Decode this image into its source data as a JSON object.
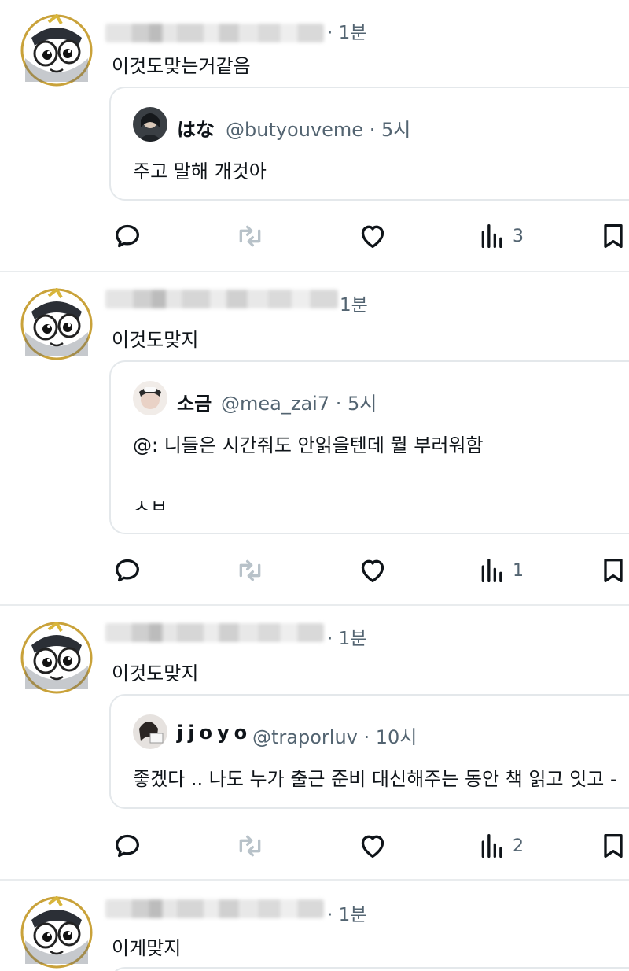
{
  "posts": [
    {
      "time": "· 1분",
      "text": "이것도맞는거같음",
      "quote": {
        "name": "はな",
        "handle": "@butyouveme · 5시",
        "lines": [
          "주고 말해 개것아"
        ]
      },
      "views": "3"
    },
    {
      "time": "1분",
      "text": "이것도맞지",
      "quote": {
        "name": "소금",
        "handle": "@mea_zai7 · 5시",
        "lines": [
          "@: 니들은 시간줘도 안읽을텐데 뭘 부러워함",
          "ㅅㅂ"
        ]
      },
      "views": "1"
    },
    {
      "time": "· 1분",
      "text": "이것도맞지",
      "quote": {
        "name": "jjoyo",
        "handle": "@traporluv · 10시",
        "lines": [
          "좋겠다 .. 나도 누가 출근 준비 대신해주는 동안 책 읽고 잇고 -"
        ]
      },
      "views": "2"
    },
    {
      "time": "· 1분",
      "text": "이게맞지"
    }
  ],
  "icons": {
    "reply": "reply-icon",
    "repost": "repost-icon",
    "like": "heart-icon",
    "views": "analytics-icon",
    "bookmark": "bookmark-icon"
  },
  "colors": {
    "text": "#0f1419",
    "secondary": "#536471",
    "border": "#e4e8eb",
    "repost_icon": "#b8c2c9"
  }
}
